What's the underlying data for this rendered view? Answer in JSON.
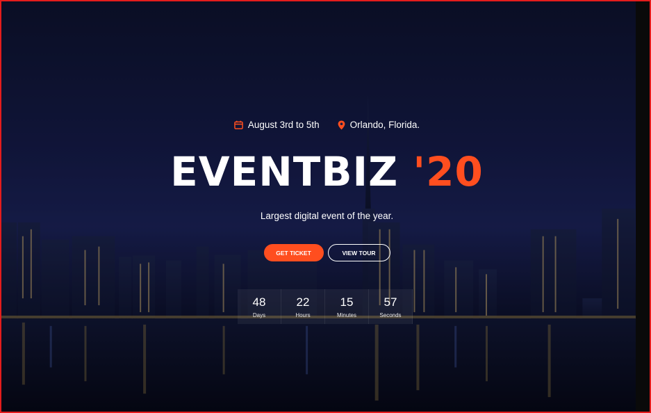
{
  "hero": {
    "date_text": "August 3rd to 5th",
    "location_text": "Orlando, Florida.",
    "title_main": "EVENTBIZ",
    "title_accent": "'20",
    "subtitle": "Largest digital event of the year.",
    "icons": {
      "date": "calendar-icon",
      "location": "map-pin-icon"
    }
  },
  "buttons": {
    "get_ticket": "GET TICKET",
    "view_tour": "VIEW TOUR"
  },
  "countdown": [
    {
      "value": "48",
      "label": "Days"
    },
    {
      "value": "22",
      "label": "Hours"
    },
    {
      "value": "15",
      "label": "Minutes"
    },
    {
      "value": "57",
      "label": "Seconds"
    }
  ],
  "colors": {
    "accent": "#ff4e1f",
    "text": "#ffffff",
    "frame_border": "#e41c1c"
  }
}
